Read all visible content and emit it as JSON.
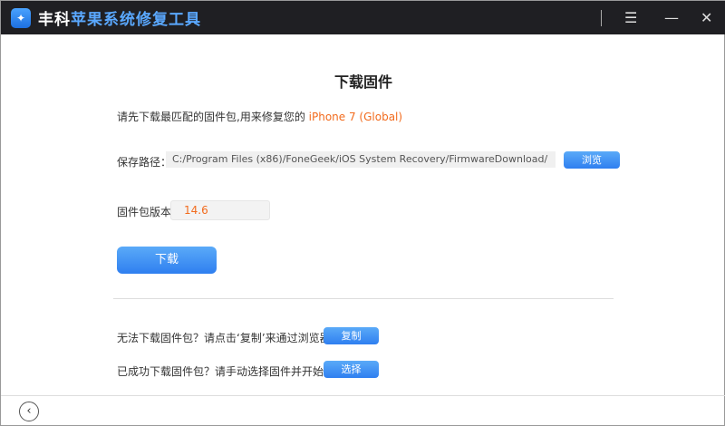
{
  "app": {
    "brand_part1": "丰科",
    "brand_part2": "苹果系统修复工具",
    "menu_icon": "☰",
    "minimize_icon": "—",
    "close_icon": "✕"
  },
  "main": {
    "title": "下载固件",
    "intro": "请先下载最匹配的固件包,用来修复您的",
    "device": "iPhone 7 (Global)",
    "save_path_label": "保存路径：",
    "save_path_value": "C:/Program Files (x86)/FoneGeek/iOS System Recovery/FirmwareDownload/",
    "browse_label": "浏览",
    "version_label": "固件包版本:",
    "version_value": "14.6",
    "download_label": "下载",
    "copy_hint": "无法下载固件包？请点击‘复制’来通过浏览器下载",
    "copy_label": "复制",
    "select_hint": "已成功下载固件包？请手动选择固件并开始修复",
    "select_label": "选择"
  },
  "footer": {
    "back_icon": "‹"
  },
  "colors": {
    "accent": "#2f7ff0",
    "highlight": "#f26b1d",
    "titlebar": "#1f1f23"
  }
}
